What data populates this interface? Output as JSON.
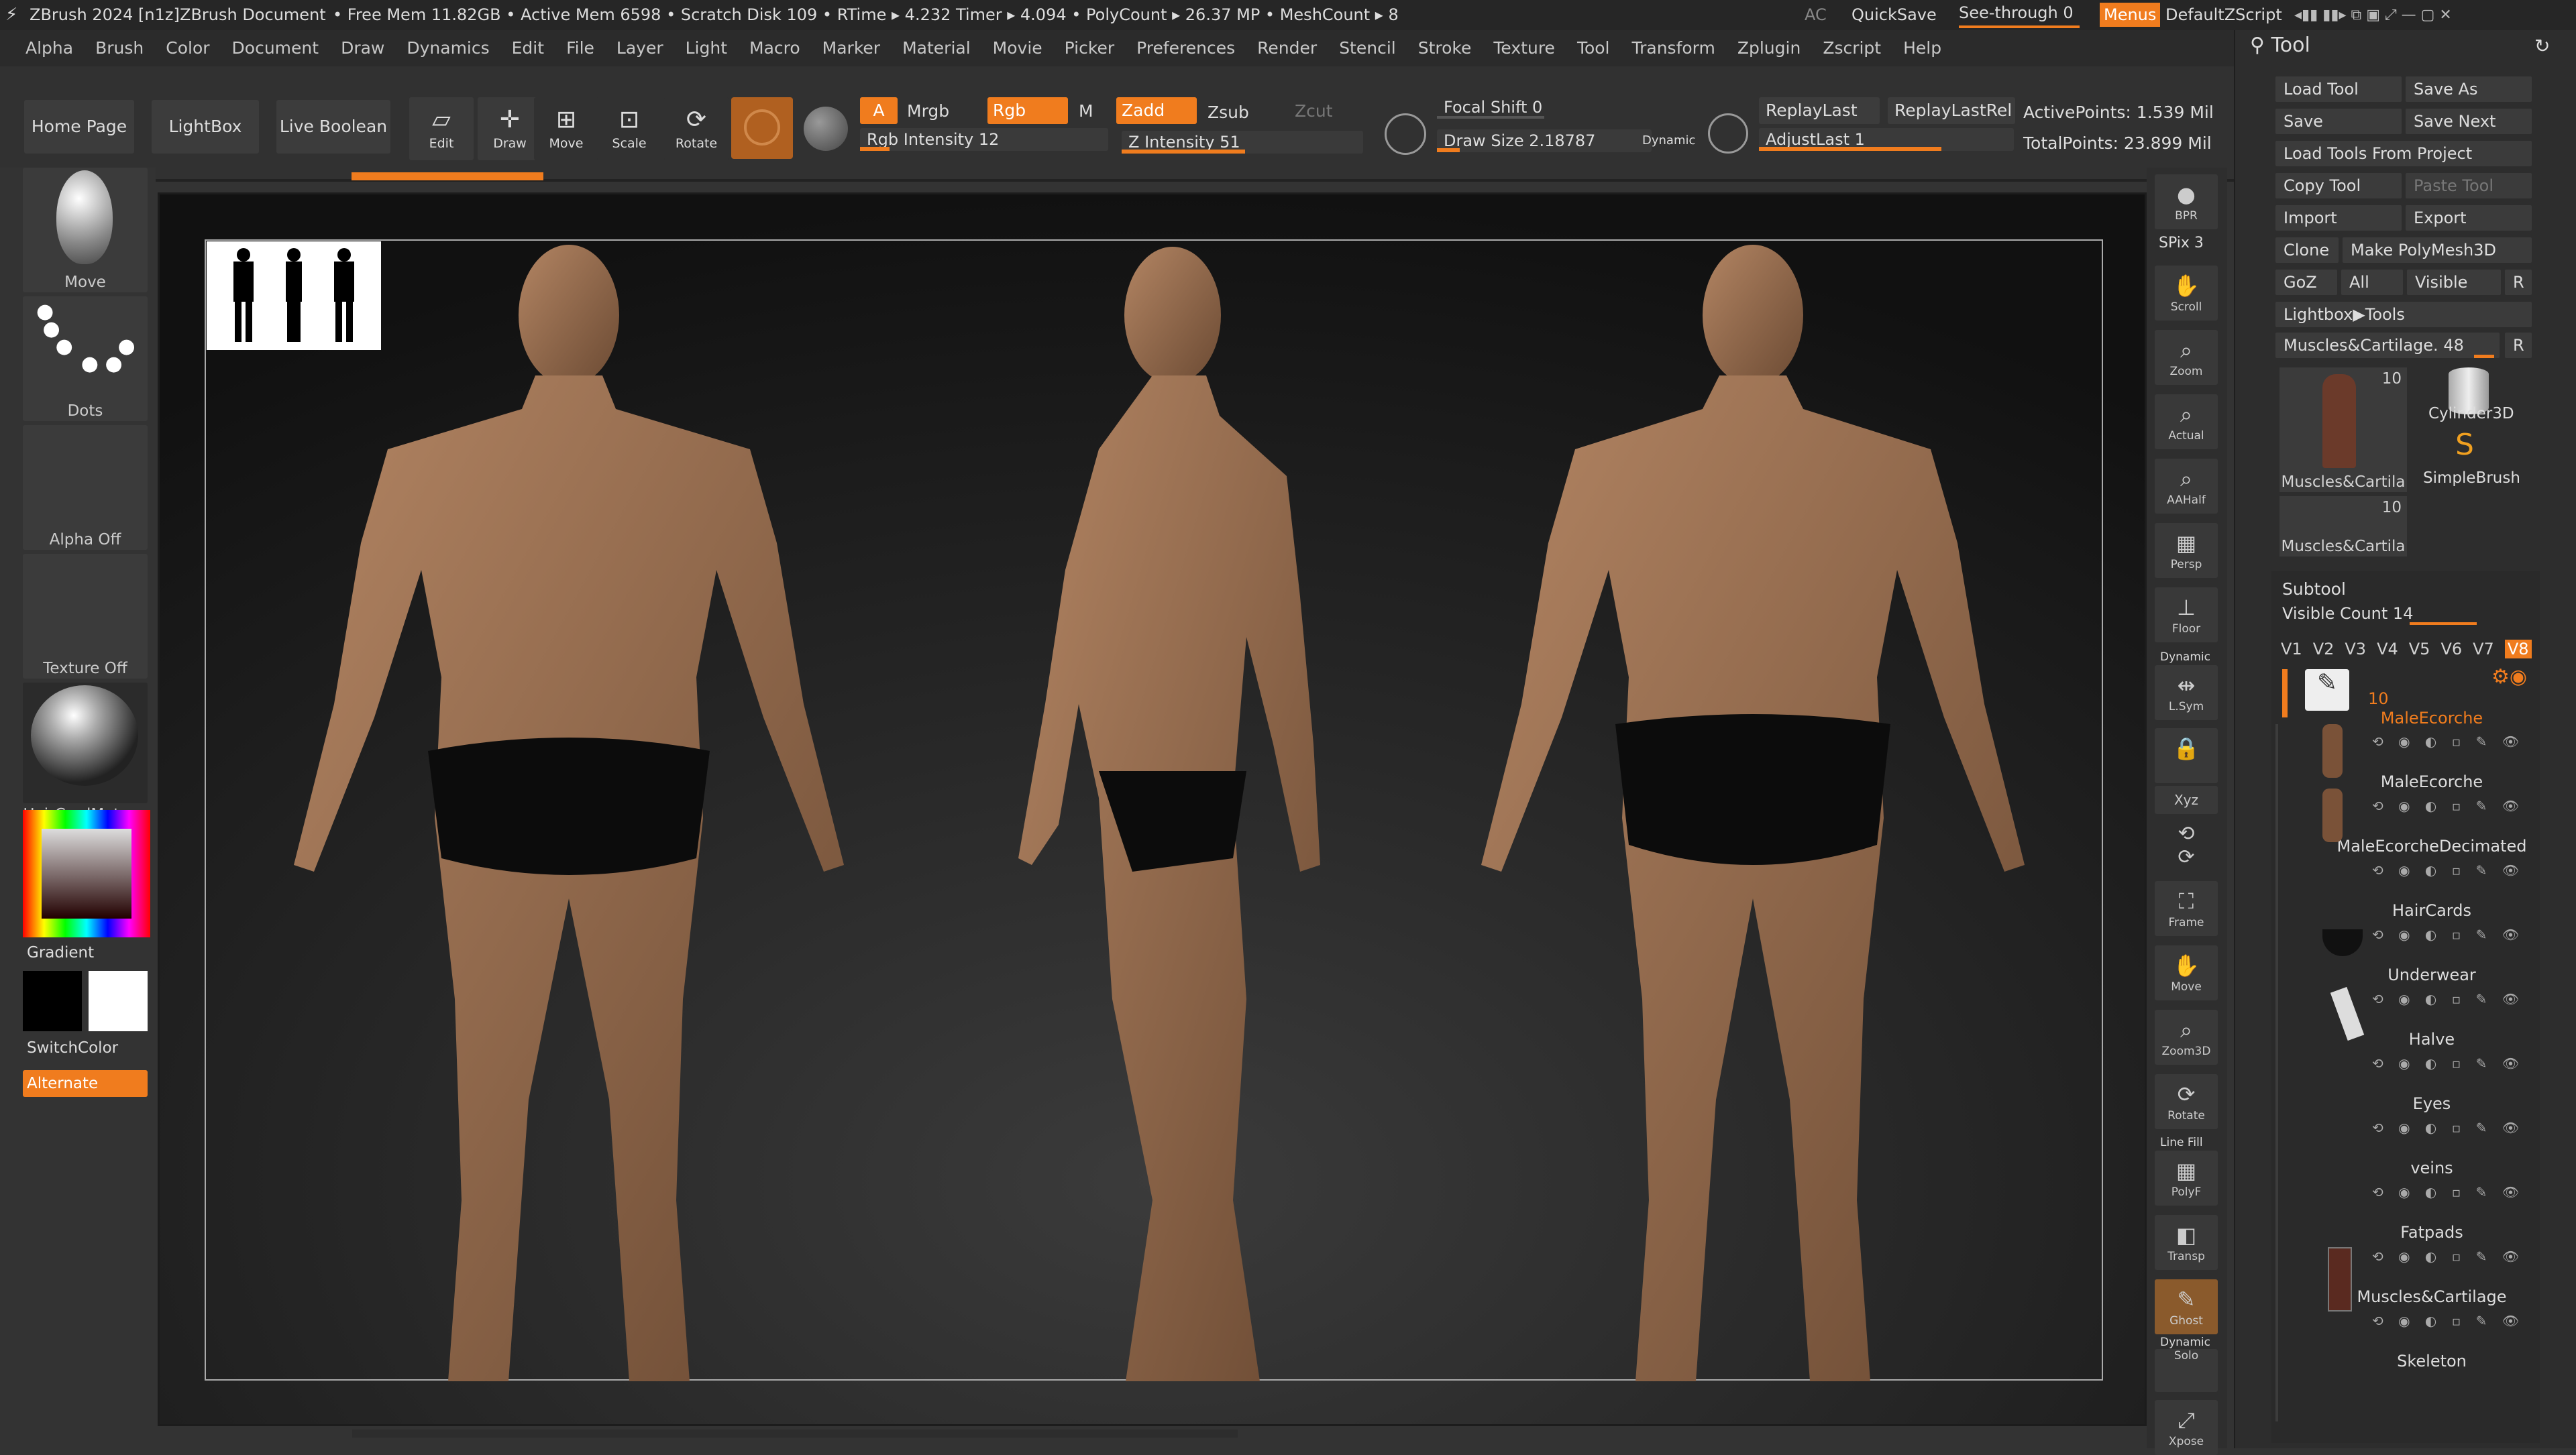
{
  "titlebar": {
    "app": "ZBrush 2024 [n1z]",
    "document": "ZBrush Document",
    "stats": "• Free Mem 11.82GB • Active Mem 6598 • Scratch Disk 109 • RTime ▸ 4.232 Timer ▸ 4.094 • PolyCount ▸ 26.37 MP • MeshCount ▸ 8",
    "ac": "AC",
    "quicksave": "QuickSave",
    "seethrough": "See-through 0",
    "menus": "Menus",
    "defaultzscript": "DefaultZScript"
  },
  "menubar": [
    "Alpha",
    "Brush",
    "Color",
    "Document",
    "Draw",
    "Dynamics",
    "Edit",
    "File",
    "Layer",
    "Light",
    "Macro",
    "Marker",
    "Material",
    "Movie",
    "Picker",
    "Preferences",
    "Render",
    "Stencil",
    "Stroke",
    "Texture",
    "Tool",
    "Transform",
    "Zplugin",
    "Zscript",
    "Help"
  ],
  "toolbar": {
    "home_page": "Home Page",
    "lightbox": "LightBox",
    "live_boolean": "Live Boolean",
    "edit": "Edit",
    "draw": "Draw",
    "move": "Move",
    "scale": "Scale",
    "rotate": "Rotate",
    "a": "A",
    "mrgb": "Mrgb",
    "rgb": "Rgb",
    "m": "M",
    "zadd": "Zadd",
    "zsub": "Zsub",
    "zcut": "Zcut",
    "rgb_intensity": "Rgb Intensity 12",
    "rgb_intensity_value": 12,
    "z_intensity": "Z Intensity 51",
    "z_intensity_value": 51,
    "focal_shift": "Focal Shift 0",
    "draw_size": "Draw Size 2.18787",
    "dynamic": "Dynamic",
    "replay_last": "ReplayLast",
    "replay_last_rel": "ReplayLastRel",
    "adjust_last": "AdjustLast 1",
    "active_points": "ActivePoints: 1.539 Mil",
    "total_points": "TotalPoints: 23.899 Mil"
  },
  "left": {
    "move": "Move",
    "dots": "Dots",
    "alpha_off": "Alpha Off",
    "texture_off": "Texture Off",
    "matcap": "HairCardMatcap",
    "gradient": "Gradient",
    "switch_color": "SwitchColor",
    "alternate": "Alternate"
  },
  "shelf": [
    "BPR",
    "SPix 3",
    "Scroll",
    "Zoom",
    "Actual",
    "AAHalf",
    "Persp",
    "Floor",
    "L.Sym",
    "Xyz",
    "Frame",
    "Move",
    "Zoom3D",
    "Rotate",
    "PolyF",
    "Transp",
    "Ghost",
    "Solo",
    "Xpose"
  ],
  "shelf_extra": {
    "dynamic": "Dynamic",
    "line_fill": "Line Fill"
  },
  "tool": {
    "title": "Tool",
    "load_tool": "Load Tool",
    "save_as": "Save As",
    "save": "Save",
    "save_next": "Save Next",
    "load_from_project": "Load Tools From Project",
    "copy_tool": "Copy Tool",
    "paste_tool": "Paste Tool",
    "import": "Import",
    "export": "Export",
    "clone": "Clone",
    "make_polymesh": "Make PolyMesh3D",
    "goz": "GoZ",
    "all": "All",
    "visible": "Visible",
    "r": "R",
    "lightbox_tools": "Lightbox▶Tools",
    "current_tool": "Muscles&Cartilage. 48",
    "thumb1_count": "10",
    "thumb1_label": "Muscles&Cartila",
    "cylinder": "Cylinder3D",
    "simplebrush": "SimpleBrush",
    "thumb2_count": "10",
    "thumb2_label": "Muscles&Cartila"
  },
  "subtool": {
    "title": "Subtool",
    "visible_count": "Visible Count 14",
    "versions": [
      "V1",
      "V2",
      "V3",
      "V4",
      "V5",
      "V6",
      "V7",
      "V8"
    ],
    "folder_count": "10",
    "items": [
      "MaleEcorche",
      "MaleEcorche",
      "MaleEcorcheDecimated",
      "HairCards",
      "Underwear",
      "Halve",
      "Eyes",
      "veins",
      "Fatpads",
      "Muscles&Cartilage",
      "Skeleton"
    ]
  },
  "colors": {
    "accent": "#f07c1e",
    "bg": "#333333"
  }
}
